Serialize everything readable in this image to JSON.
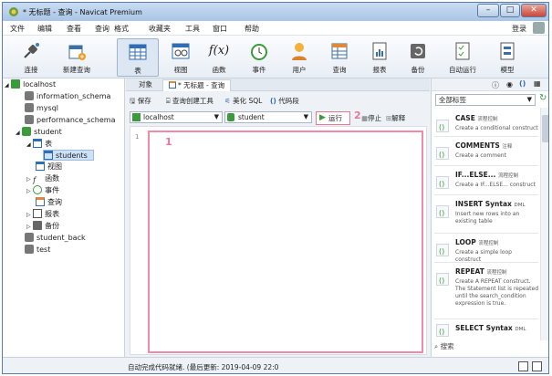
{
  "window": {
    "title": "* 无标题 - 查询 - Navicat Premium",
    "min": "–",
    "max": "□",
    "close": "✕"
  },
  "menu": [
    "文件",
    "编辑",
    "查看",
    "查询",
    "格式",
    "收藏夹",
    "工具",
    "窗口",
    "帮助"
  ],
  "login": "登录",
  "toolbar": [
    {
      "label": "连接",
      "icon": "plug-icon"
    },
    {
      "label": "新建查询",
      "icon": "new-query-icon"
    },
    {
      "label": "表",
      "icon": "table-icon",
      "active": true
    },
    {
      "label": "视图",
      "icon": "view-icon"
    },
    {
      "label": "函数",
      "icon": "function-icon",
      "glyph": "f(x)"
    },
    {
      "label": "事件",
      "icon": "clock-icon"
    },
    {
      "label": "用户",
      "icon": "user-icon"
    },
    {
      "label": "查询",
      "icon": "query-icon"
    },
    {
      "label": "报表",
      "icon": "report-icon"
    },
    {
      "label": "备份",
      "icon": "backup-icon"
    },
    {
      "label": "自动运行",
      "icon": "auto-run-icon"
    },
    {
      "label": "模型",
      "icon": "model-icon"
    }
  ],
  "tree": [
    {
      "label": "localhost",
      "level": 0,
      "expander": "◢",
      "icon": "connection-icon"
    },
    {
      "label": "information_schema",
      "level": 1,
      "icon": "db-icon"
    },
    {
      "label": "mysql",
      "level": 1,
      "icon": "db-icon"
    },
    {
      "label": "performance_schema",
      "level": 1,
      "icon": "db-icon"
    },
    {
      "label": "student",
      "level": 1,
      "expander": "◢",
      "icon": "db-green-icon"
    },
    {
      "label": "表",
      "level": 2,
      "expander": "◢",
      "icon": "table-icon"
    },
    {
      "label": "students",
      "level": 3,
      "icon": "table-icon",
      "selected": true
    },
    {
      "label": "视图",
      "level": 2,
      "icon": "view-icon"
    },
    {
      "label": "函数",
      "level": 2,
      "expander": "▷",
      "icon": "function-icon"
    },
    {
      "label": "事件",
      "level": 2,
      "expander": "▷",
      "icon": "clock-icon"
    },
    {
      "label": "查询",
      "level": 2,
      "icon": "query-icon"
    },
    {
      "label": "报表",
      "level": 2,
      "expander": "▷",
      "icon": "report-icon"
    },
    {
      "label": "备份",
      "level": 2,
      "expander": "▷",
      "icon": "backup-icon"
    },
    {
      "label": "student_back",
      "level": 1,
      "icon": "db-icon"
    },
    {
      "label": "test",
      "level": 1,
      "icon": "db-icon"
    }
  ],
  "tabs": {
    "object": "对象",
    "query": "* 无标题 - 查询"
  },
  "query_toolbar": {
    "save": "保存",
    "builder": "查询创建工具",
    "beautify": "美化 SQL",
    "snippet": "代码段"
  },
  "connection": "localhost",
  "database": "student",
  "run": "运行",
  "stop": "停止",
  "explain": "解释",
  "line_number": "1",
  "annotations": {
    "editor": "1",
    "run": "2"
  },
  "right_panel": {
    "tag_select": "全部标签",
    "search": "搜索",
    "snippets": [
      {
        "title": "CASE",
        "tag": "流程控制",
        "desc": "Create a conditional construct"
      },
      {
        "title": "COMMENTS",
        "tag": "注释",
        "desc": "Create a comment"
      },
      {
        "title": "IF...ELSE...",
        "tag": "流程控制",
        "desc": "Create a IF...ELSE... construct"
      },
      {
        "title": "INSERT Syntax",
        "tag": "DML",
        "desc": "Insert new rows into an existing table"
      },
      {
        "title": "LOOP",
        "tag": "流程控制",
        "desc": "Create a simple loop construct"
      },
      {
        "title": "REPEAT",
        "tag": "流程控制",
        "desc": "Create A REPEAT construct. The Statement list is repeated until the search_condition expression is true."
      },
      {
        "title": "SELECT Syntax",
        "tag": "DML",
        "desc": ""
      }
    ]
  },
  "status": "自动完成代码就绪. (最后更新: 2019-04-09 22:0"
}
